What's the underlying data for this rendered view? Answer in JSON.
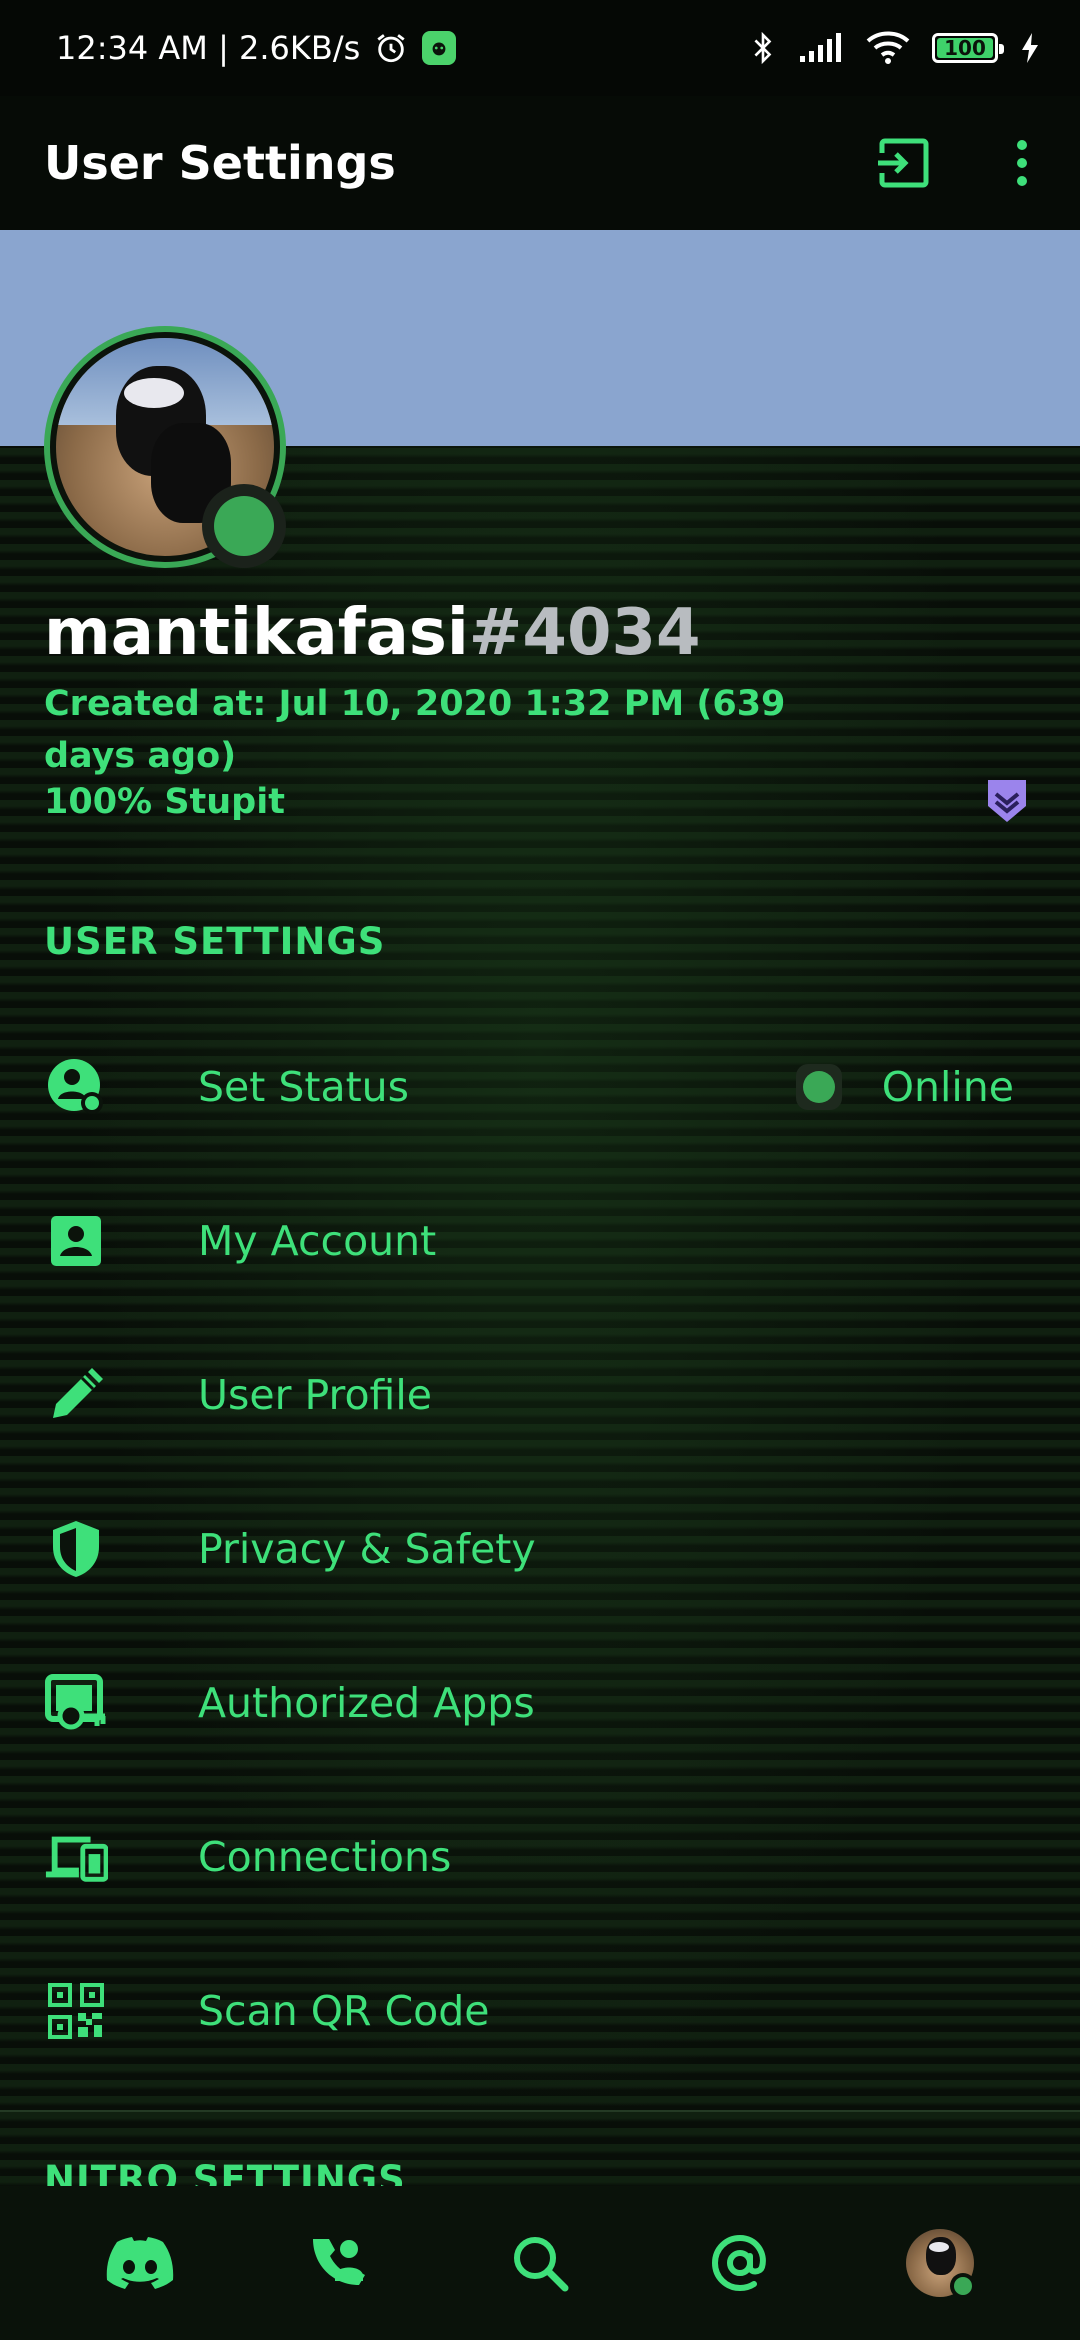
{
  "status_bar": {
    "time_speed": "12:34 AM | 2.6KB/s",
    "battery": "100"
  },
  "app_bar": {
    "title": "User Settings"
  },
  "profile": {
    "username": "mantikafasi",
    "discriminator": "#4034",
    "created_at": "Created at: Jul 10, 2020 1:32 PM (639 days ago)",
    "bio": "100% Stupit"
  },
  "user_settings": {
    "header": "USER SETTINGS",
    "items": [
      {
        "label": "Set Status",
        "value": "Online",
        "icon": "status-icon"
      },
      {
        "label": "My Account",
        "icon": "account-icon"
      },
      {
        "label": "User Profile",
        "icon": "pencil-icon"
      },
      {
        "label": "Privacy & Safety",
        "icon": "shield-icon"
      },
      {
        "label": "Authorized Apps",
        "icon": "authorized-apps-icon"
      },
      {
        "label": "Connections",
        "icon": "devices-icon"
      },
      {
        "label": "Scan QR Code",
        "icon": "qr-code-icon"
      }
    ]
  },
  "nitro_settings": {
    "header": "NITRO SETTINGS"
  },
  "bottom_nav": {
    "items": [
      "discord-home-icon",
      "friends-icon",
      "search-icon",
      "mentions-icon",
      "profile-avatar"
    ]
  },
  "colors": {
    "accent": "#3ee07a",
    "banner": "#8aa5cf",
    "online": "#3aa856",
    "background": "#0b130b"
  }
}
